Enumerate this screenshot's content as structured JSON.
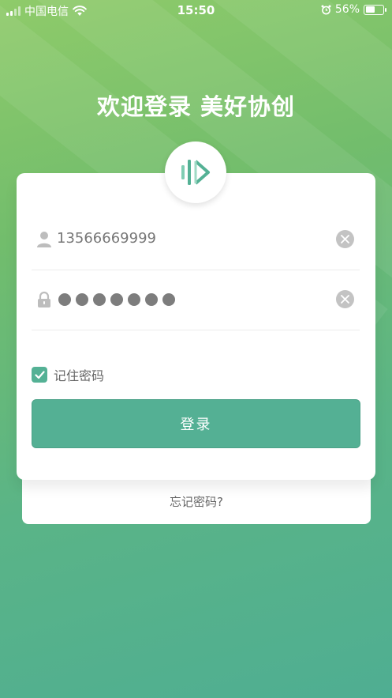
{
  "status_bar": {
    "carrier": "中国电信",
    "time": "15:50",
    "battery_percent": "56%",
    "battery_level": 0.56,
    "icons": [
      "signal-icon",
      "wifi-icon",
      "alarm-icon",
      "battery-icon"
    ]
  },
  "welcome_title": "欢迎登录 美好协创",
  "logo": {
    "icon": "app-logo-icon",
    "brand_color": "#54b195"
  },
  "form": {
    "username": {
      "value": "13566669999",
      "icon": "user-icon",
      "clear_icon": "clear-icon"
    },
    "password": {
      "masked_length": 7,
      "icon": "lock-icon",
      "clear_icon": "clear-icon"
    },
    "remember_label": "记住密码",
    "remember_checked": true,
    "login_label": "登录",
    "forgot_label": "忘记密码?"
  },
  "colors": {
    "accent": "#54b195",
    "gradient_top": "#8fcb6a",
    "gradient_bottom": "#4fae92"
  }
}
